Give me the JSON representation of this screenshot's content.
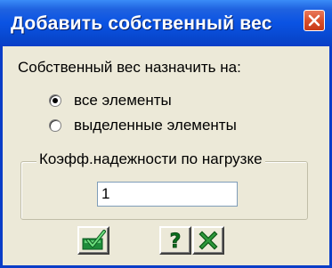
{
  "window": {
    "title": "Добавить собственный вес",
    "close_icon": "close-icon"
  },
  "form": {
    "assign_label": "Собственный вес назначить на:",
    "options": [
      {
        "label": "все элементы",
        "checked": true
      },
      {
        "label": "выделенные элементы",
        "checked": false
      }
    ],
    "group_label": "Коэфф.надежности по нагрузке",
    "coefficient_value": "1"
  },
  "buttons": {
    "apply_icon": "apply-checkmark-icon",
    "help_icon": "help-question-icon",
    "cancel_icon": "cancel-x-icon"
  },
  "colors": {
    "titlebar": "#0A53E3",
    "window_bg": "#ECE9D8",
    "close_button": "#D9502C",
    "apply_green": "#1E8C3A",
    "help_green": "#2E7D32"
  }
}
